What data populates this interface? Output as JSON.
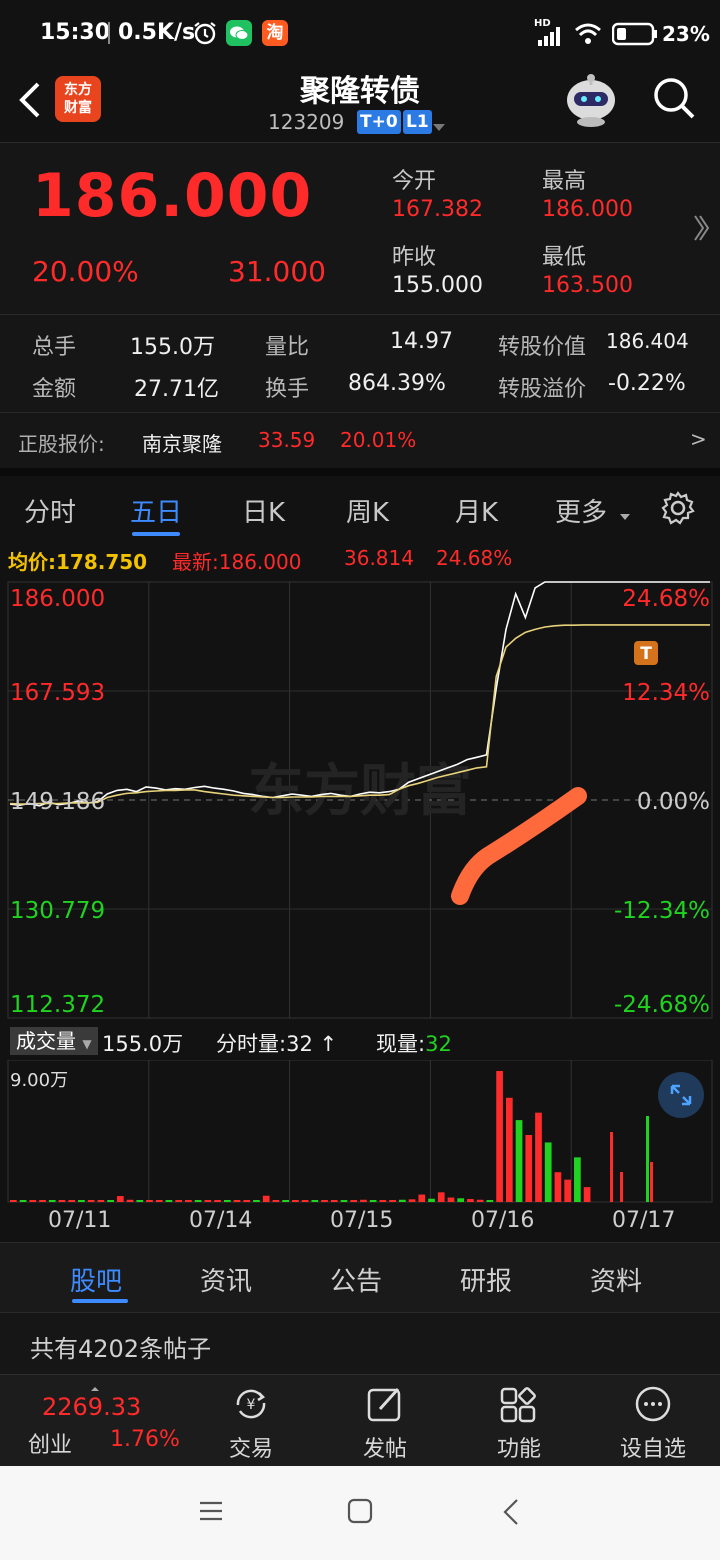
{
  "statusbar": {
    "time": "15:30",
    "speed": "0.5K/s",
    "signal": "HD",
    "battery": "23"
  },
  "header": {
    "logo_line1": "东方",
    "logo_line2": "财富",
    "title": "聚隆转债",
    "code": "123209",
    "tag1": "T+0",
    "tag2": "L1"
  },
  "quote": {
    "price": "186.000",
    "change_pct": "20.00%",
    "change": "31.000",
    "open_label": "今开",
    "open": "167.382",
    "high_label": "最高",
    "high": "186.000",
    "prev_close_label": "昨收",
    "prev_close": "155.000",
    "low_label": "最低",
    "low": "163.500"
  },
  "stats": {
    "volume_label": "总手",
    "volume": "155.0万",
    "vol_ratio_label": "量比",
    "vol_ratio": "14.97",
    "conv_value_label": "转股价值",
    "conv_value": "186.404",
    "amount_label": "金额",
    "amount": "27.71亿",
    "turnover_label": "换手",
    "turnover": "864.39%",
    "premium_label": "转股溢价",
    "premium": "-0.22%"
  },
  "stock_row": {
    "label": "正股报价:",
    "name": "南京聚隆",
    "price": "33.59",
    "pct": "20.01%",
    "arrow": ">"
  },
  "tabs": [
    "分时",
    "五日",
    "日K",
    "周K",
    "月K",
    "更多"
  ],
  "infobar": {
    "avg_label": "均价:",
    "avg": "178.750",
    "latest_label": "最新:",
    "latest": "186.000",
    "change": "36.814",
    "pct": "24.68%"
  },
  "chart_data": {
    "type": "line",
    "title": "",
    "watermark": "东方财富",
    "x_labels": [
      "07/11",
      "07/14",
      "07/15",
      "07/16",
      "07/17"
    ],
    "y_ticks_left": [
      "186.000",
      "167.593",
      "149.186",
      "130.779",
      "112.372"
    ],
    "y_ticks_right": [
      "24.68%",
      "12.34%",
      "0.00%",
      "-12.34%",
      "-24.68%"
    ],
    "ylim": [
      112.372,
      186.0
    ],
    "baseline": 149.186,
    "series": [
      {
        "name": "最新",
        "color": "#ffffff",
        "values": [
          148.5,
          148.3,
          148.6,
          148.2,
          148.8,
          148.4,
          148.6,
          149.0,
          148.7,
          148.9,
          150.2,
          150.8,
          151.0,
          150.6,
          151.4,
          151.2,
          150.9,
          151.1,
          151.0,
          151.3,
          151.5,
          151.2,
          151.0,
          150.7,
          150.3,
          150.1,
          149.8,
          149.6,
          149.9,
          150.2,
          150.0,
          149.8,
          150.1,
          150.3,
          150.0,
          149.8,
          150.2,
          150.5,
          150.4,
          150.6,
          151.0,
          152.2,
          152.8,
          153.4,
          154.0,
          154.6,
          155.2,
          156.0,
          156.4,
          156.8,
          168.0,
          178.0,
          184.0,
          180.0,
          185.0,
          186.0,
          186.0,
          186.0,
          186.0,
          186.0
        ]
      },
      {
        "name": "均价",
        "color": "#e8d27a",
        "values": [
          148.6,
          148.5,
          148.5,
          148.6,
          148.6,
          148.6,
          148.7,
          148.7,
          148.7,
          148.8,
          149.6,
          150.0,
          150.3,
          150.4,
          150.6,
          150.7,
          150.8,
          150.8,
          150.9,
          150.9,
          150.6,
          150.4,
          150.2,
          150.0,
          149.9,
          149.8,
          149.7,
          149.6,
          149.6,
          149.7,
          149.7,
          149.7,
          149.8,
          149.8,
          149.8,
          149.8,
          149.9,
          150.0,
          150.0,
          150.1,
          151.0,
          151.6,
          152.0,
          152.5,
          153.0,
          153.4,
          153.8,
          154.2,
          154.6,
          154.8,
          170.0,
          175.0,
          176.5,
          177.5,
          178.0,
          178.4,
          178.6,
          178.7,
          178.7,
          178.75
        ]
      }
    ],
    "volume": {
      "label": "成交量",
      "total": "155.0万",
      "minute_label": "分时量:",
      "minute": "32",
      "current_label": "现量:",
      "current": "32",
      "ymax_label": "9.00万",
      "ymax": 90000,
      "values": [
        800,
        600,
        500,
        400,
        700,
        500,
        600,
        900,
        500,
        600,
        1200,
        4000,
        1500,
        900,
        800,
        700,
        600,
        500,
        700,
        800,
        900,
        700,
        600,
        800,
        500,
        600,
        4200,
        900,
        700,
        600,
        800,
        700,
        900,
        600,
        700,
        800,
        1500,
        900,
        1200,
        1000,
        1500,
        1800,
        5000,
        2200,
        6500,
        3000,
        2500,
        2000,
        1500,
        1000,
        88000,
        70000,
        55000,
        45000,
        60000,
        40000,
        20000,
        15000,
        30000,
        10000
      ]
    }
  },
  "bottom_tabs": [
    "股吧",
    "资讯",
    "公告",
    "研报",
    "资料"
  ],
  "post_count": "共有4202条帖子",
  "toolbar": {
    "index_value": "2269.33",
    "index_name": "创业",
    "index_pct": "1.76%",
    "trade": "交易",
    "post": "发帖",
    "func": "功能",
    "watch": "设自选"
  }
}
